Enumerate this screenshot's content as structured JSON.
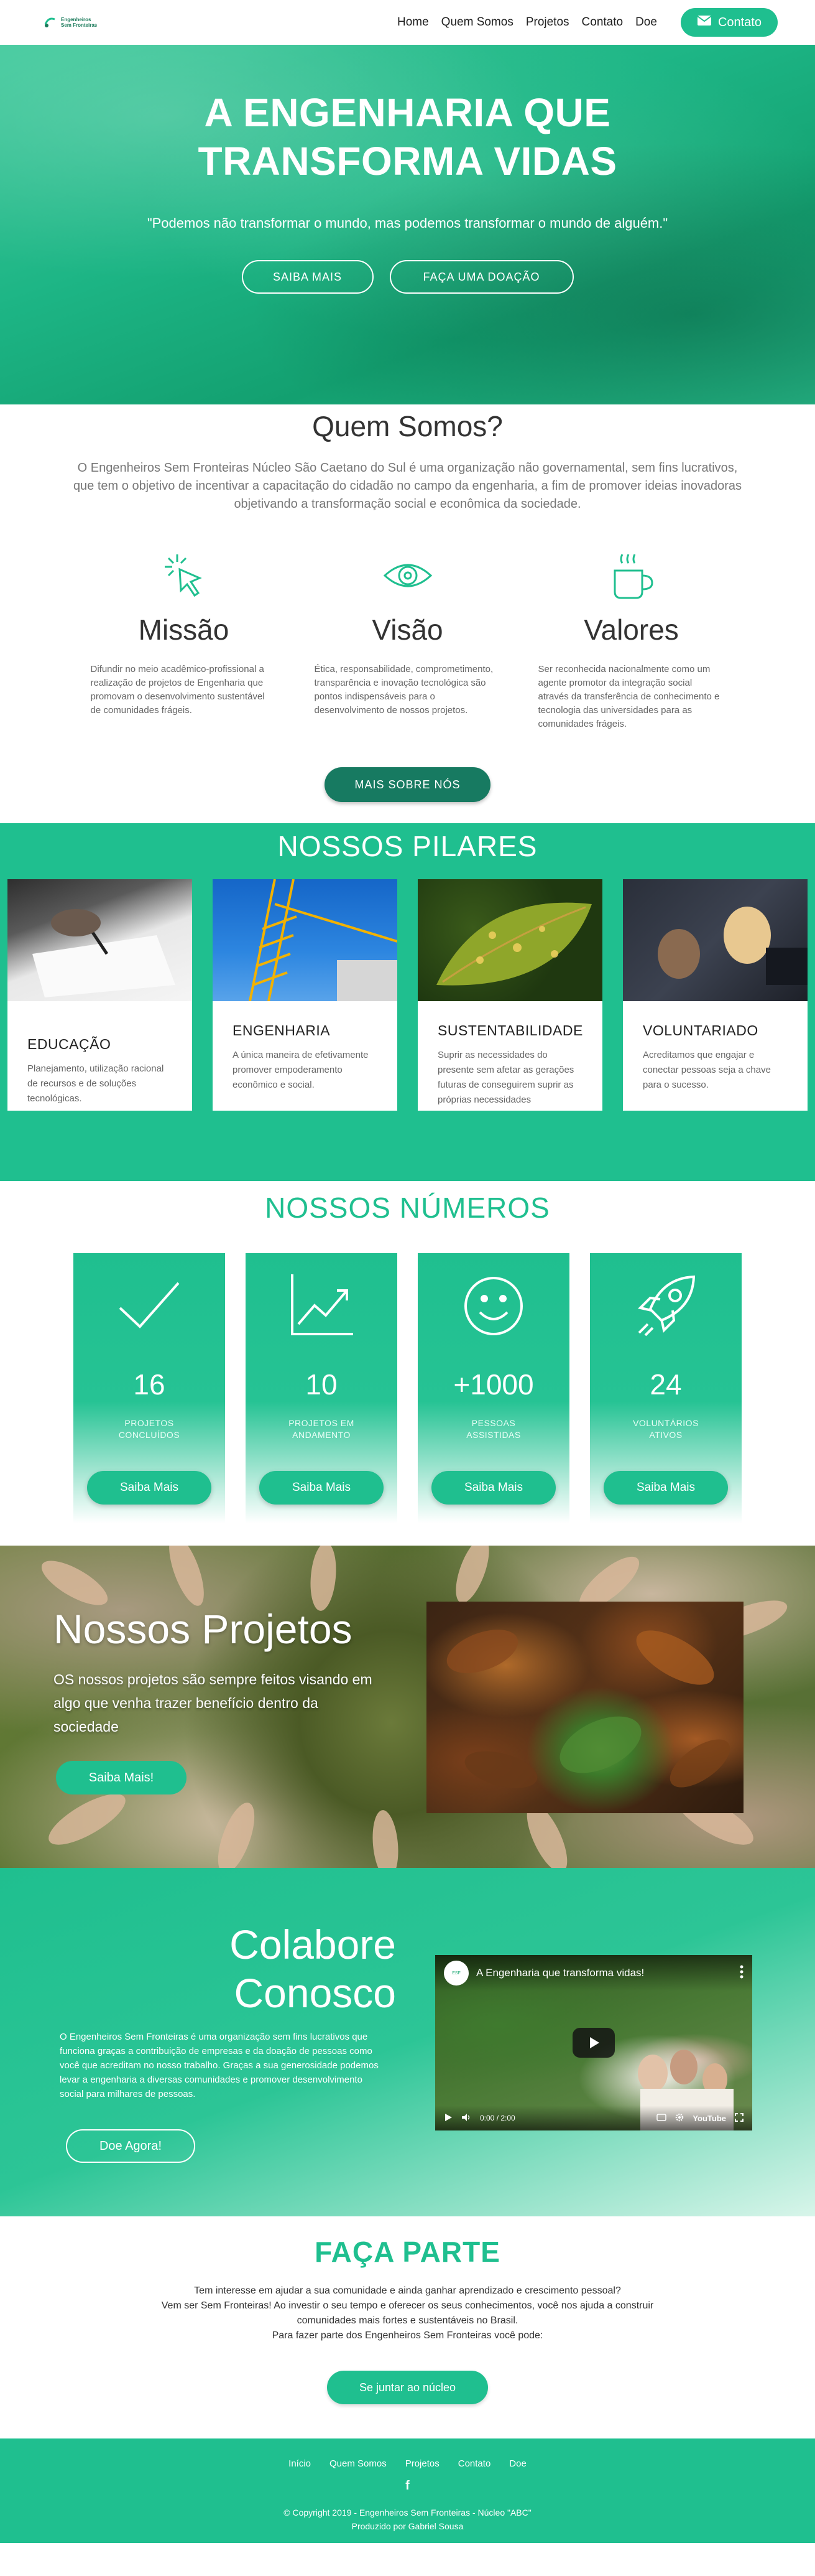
{
  "nav": {
    "logo_line1": "Engenheiros",
    "logo_line2": "Sem Fronteiras",
    "links": [
      "Home",
      "Quem Somos",
      "Projetos",
      "Contato",
      "Doe"
    ],
    "contact_label": "Contato"
  },
  "hero": {
    "title_line1": "A ENGENHARIA QUE",
    "title_line2": "TRANSFORMA VIDAS",
    "quote": "\"Podemos não transformar o mundo, mas podemos transformar o mundo de alguém.\"",
    "btn_saiba": "SAIBA MAIS",
    "btn_doacao": "FAÇA UMA DOAÇÃO"
  },
  "quem": {
    "title": "Quem Somos?",
    "text": "O Engenheiros Sem Fronteiras Núcleo São Caetano do Sul é uma organização não governamental, sem fins lucrativos, que tem o objetivo de incentivar a capacitação do cidadão no campo da engenharia, a fim de promover ideias inovadoras objetivando a transformação social e econômica da sociedade.",
    "cols": [
      {
        "title": "Missão",
        "text": "Difundir no meio acadêmico-profissional a realização de projetos de Engenharia que promovam o desenvolvimento sustentável de comunidades frágeis."
      },
      {
        "title": "Visão",
        "text": "Ética, responsabilidade, comprometimento, transparência e inovação tecnológica são pontos indispensáveis para o desenvolvimento de nossos projetos."
      },
      {
        "title": "Valores",
        "text": "Ser reconhecida nacionalmente como um agente promotor da integração social através da transferência de conhecimento e tecnologia das universidades para as comunidades frágeis."
      }
    ],
    "btn": "MAIS SOBRE NÓS"
  },
  "pilares": {
    "title": "NOSSOS PILARES",
    "cards": [
      {
        "title": "EDUCAÇÃO",
        "text": "Planejamento, utilização racional de recursos e de soluções tecnológicas."
      },
      {
        "title": "ENGENHARIA",
        "text": "A única maneira de efetivamente promover empoderamento econômico e social."
      },
      {
        "title": "SUSTENTABILIDADE",
        "text": "Suprir as necessidades do presente sem afetar as gerações futuras de conseguirem suprir as próprias necessidades"
      },
      {
        "title": "VOLUNTARIADO",
        "text": "Acreditamos que engajar e conectar pessoas seja a chave para o sucesso."
      }
    ]
  },
  "numeros": {
    "title": "NOSSOS NÚMEROS",
    "cards": [
      {
        "value": "16",
        "label": "PROJETOS CONCLUÍDOS",
        "btn": "Saiba Mais"
      },
      {
        "value": "10",
        "label": "PROJETOS EM ANDAMENTO",
        "btn": "Saiba Mais"
      },
      {
        "value": "+1000",
        "label": "PESSOAS ASSISTIDAS",
        "btn": "Saiba Mais"
      },
      {
        "value": "24",
        "label": "VOLUNTÁRIOS ATIVOS",
        "btn": "Saiba Mais"
      }
    ]
  },
  "projetos": {
    "title": "Nossos Projetos",
    "text": "OS nossos projetos são sempre feitos visando em algo que venha trazer benefício dentro da sociedade",
    "btn": "Saiba Mais!"
  },
  "colabore": {
    "title_line1": "Colabore",
    "title_line2": "Conosco",
    "text": "O Engenheiros Sem Fronteiras é uma organização sem fins lucrativos que funciona graças a contribuição de empresas e da doação de pessoas como você que acreditam no nosso trabalho. Graças a sua generosidade podemos levar a engenharia a diversas comunidades e promover desenvolvimento social para milhares de pessoas.",
    "btn": "Doe Agora!",
    "video_title": "A Engenharia que transforma vidas!",
    "video_time": "0:00 / 2:00",
    "video_brand": "YouTube"
  },
  "faca": {
    "title": "FAÇA PARTE",
    "line1": "Tem interesse em ajudar a sua comunidade e ainda ganhar aprendizado e crescimento pessoal?",
    "line2": "Vem ser Sem Fronteiras! Ao investir o seu tempo e oferecer os seus conhecimentos, você nos ajuda a construir",
    "line3": "comunidades mais fortes e sustentáveis no Brasil.",
    "line4": "Para fazer parte dos Engenheiros Sem Fronteiras você pode:",
    "btn": "Se juntar ao núcleo"
  },
  "footer": {
    "links": [
      "Início",
      "Quem Somos",
      "Projetos",
      "Contato",
      "Doe"
    ],
    "fb": "f",
    "copyright": "© Copyright 2019 - Engenheiros Sem Fronteiras - Núcleo \"ABC\"",
    "credit": "Produzido por Gabriel Sousa"
  }
}
